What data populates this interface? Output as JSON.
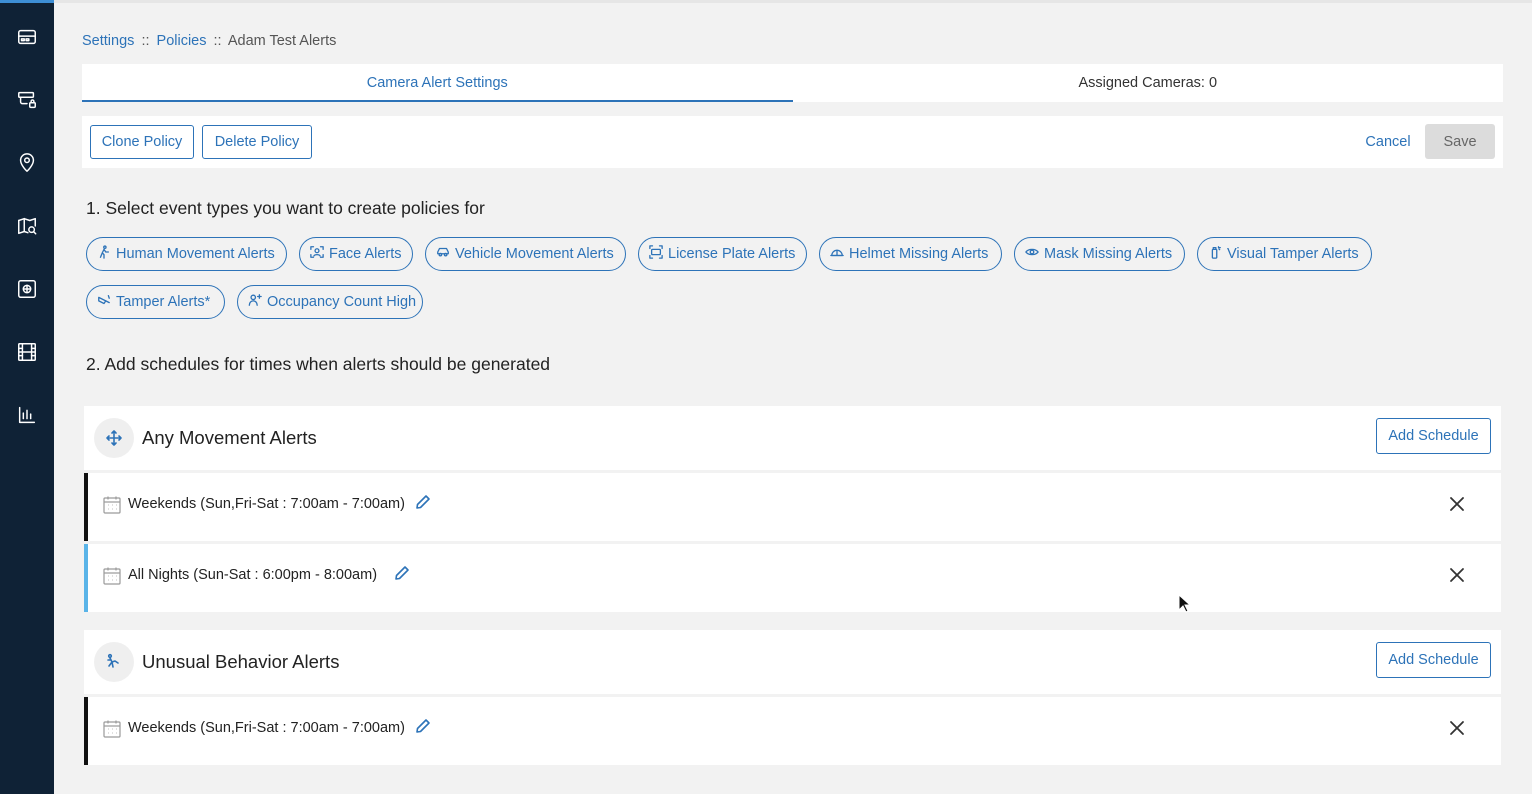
{
  "sidebar": {
    "icons": [
      "dashboard-icon",
      "camera-lock-icon",
      "location-pin-icon",
      "map-search-icon",
      "media-box-icon",
      "film-icon",
      "bar-chart-icon"
    ]
  },
  "breadcrumb": {
    "settings": "Settings",
    "separator": "::",
    "policies": "Policies",
    "current": "Adam Test Alerts"
  },
  "tabs": [
    {
      "label": "Camera Alert Settings",
      "active": true
    },
    {
      "label": "Assigned Cameras: 0",
      "active": false
    }
  ],
  "actions": {
    "clone": "Clone Policy",
    "delete": "Delete Policy",
    "cancel": "Cancel",
    "save": "Save"
  },
  "section1": {
    "title": "1. Select event types you want to create policies for",
    "chips": [
      {
        "label": "Human Movement Alerts",
        "icon": "walking-person-icon"
      },
      {
        "label": "Face Alerts",
        "icon": "face-scan-icon"
      },
      {
        "label": "Vehicle Movement Alerts",
        "icon": "car-icon"
      },
      {
        "label": "License Plate Alerts",
        "icon": "license-plate-icon"
      },
      {
        "label": "Helmet Missing Alerts",
        "icon": "helmet-icon"
      },
      {
        "label": "Mask Missing Alerts",
        "icon": "mask-icon"
      },
      {
        "label": "Visual Tamper Alerts",
        "icon": "spray-can-icon"
      },
      {
        "label": "Tamper Alerts*",
        "icon": "tamper-icon"
      },
      {
        "label": "Occupancy Count High",
        "icon": "person-add-icon"
      }
    ]
  },
  "section2": {
    "title": "2. Add schedules for times when alerts should be generated",
    "groups": [
      {
        "title": "Any Movement Alerts",
        "icon": "move-arrows-icon",
        "add_label": "Add Schedule",
        "schedules": [
          {
            "label": "Weekends (Sun,Fri-Sat : 7:00am - 7:00am)"
          },
          {
            "label": "All Nights (Sun-Sat : 6:00pm - 8:00am)"
          }
        ]
      },
      {
        "title": "Unusual Behavior Alerts",
        "icon": "running-person-icon",
        "add_label": "Add Schedule",
        "schedules": [
          {
            "label": "Weekends (Sun,Fri-Sat : 7:00am - 7:00am)"
          }
        ]
      }
    ]
  },
  "colors": {
    "sidebar": "#0f2236",
    "accent": "#2d73b8",
    "row_highlight": "#5ab4e8"
  }
}
